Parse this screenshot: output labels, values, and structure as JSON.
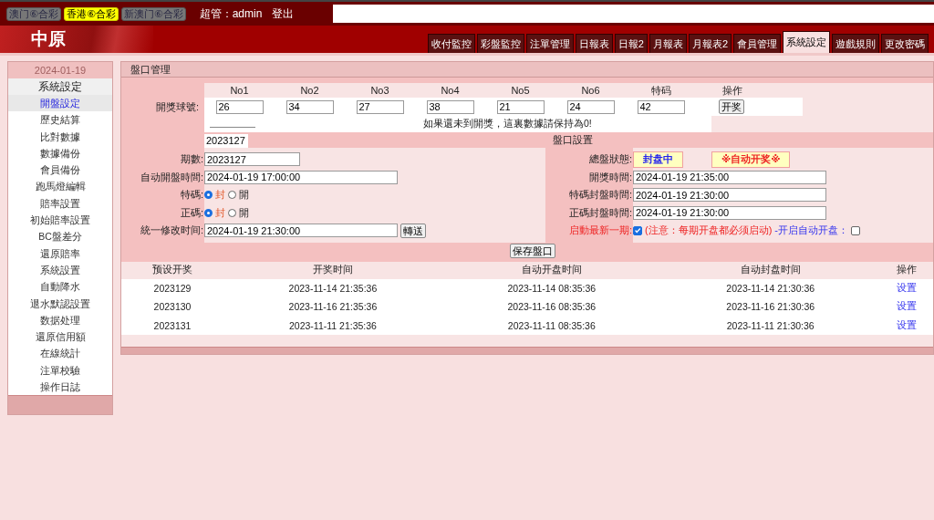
{
  "top_bar": {
    "lotteries": [
      {
        "label": "澳门⑥合彩",
        "selected": false
      },
      {
        "label": "香港⑥合彩",
        "selected": true
      },
      {
        "label": "新澳门⑥合彩",
        "selected": false
      }
    ],
    "user": "超管：admin",
    "logout": "登出"
  },
  "logo": "中原",
  "tabs": [
    {
      "label": "收付監控",
      "selected": false
    },
    {
      "label": "彩盤監控",
      "selected": false
    },
    {
      "label": "注單管理",
      "selected": false
    },
    {
      "label": "日報表",
      "selected": false
    },
    {
      "label": "日報2",
      "selected": false
    },
    {
      "label": "月報表",
      "selected": false
    },
    {
      "label": "月報表2",
      "selected": false
    },
    {
      "label": "會員管理",
      "selected": false
    },
    {
      "label": "系統設定",
      "selected": true
    },
    {
      "label": "遊戲規則",
      "selected": false
    },
    {
      "label": "更改密碼",
      "selected": false
    }
  ],
  "sidebar": {
    "date": "2024-01-19",
    "title": "系統設定",
    "items": [
      {
        "label": "開盤設定",
        "selected": true
      },
      {
        "label": "歷史結算",
        "selected": false
      },
      {
        "label": "比對數據",
        "selected": false
      },
      {
        "label": "數據備份",
        "selected": false
      },
      {
        "label": "會員備份",
        "selected": false
      },
      {
        "label": "跑馬燈編輯",
        "selected": false
      },
      {
        "label": "賠率設置",
        "selected": false
      },
      {
        "label": "初始賠率設置",
        "selected": false
      },
      {
        "label": "BC盤差分",
        "selected": false
      },
      {
        "label": "還原賠率",
        "selected": false
      },
      {
        "label": "系統設置",
        "selected": false
      },
      {
        "label": "自動降水",
        "selected": false
      },
      {
        "label": "退水默認設置",
        "selected": false
      },
      {
        "label": "数据处理",
        "selected": false
      },
      {
        "label": "還原信用額",
        "selected": false
      },
      {
        "label": "在線統計",
        "selected": false
      },
      {
        "label": "注單校驗",
        "selected": false
      },
      {
        "label": "操作日誌",
        "selected": false
      }
    ]
  },
  "panel": {
    "title": "盤口管理",
    "balls": {
      "label": "開獎球號:",
      "columns": [
        "No1",
        "No2",
        "No3",
        "No4",
        "No5",
        "No6",
        "特码"
      ],
      "action_header": "操作",
      "values": [
        "26",
        "34",
        "27",
        "38",
        "21",
        "24",
        "42"
      ],
      "button": "开奖",
      "notice": "如果還未到開獎，這裏數據請保持為0!"
    },
    "issue_field": "2023127",
    "section_title": "盤口設置",
    "left_fields": [
      {
        "kind": "text",
        "label": "期數:",
        "value": "2023127"
      },
      {
        "kind": "text",
        "label": "自动開盤時間:",
        "value": "2024-01-19 17:00:00"
      },
      {
        "kind": "radio",
        "label": "特碼:",
        "options": [
          {
            "label": "封",
            "selected": true
          },
          {
            "label": "開",
            "selected": false
          }
        ]
      },
      {
        "kind": "radio",
        "label": "正碼:",
        "options": [
          {
            "label": "封",
            "selected": true
          },
          {
            "label": "開",
            "selected": false
          }
        ]
      },
      {
        "kind": "text",
        "label": "統一修改时间:",
        "value": "2024-01-19 21:30:00",
        "button": "轉送"
      }
    ],
    "status": {
      "label": "總盤狀態:",
      "state": "封盘中",
      "auto": "※自动开奖※"
    },
    "right_fields": [
      {
        "label": "開獎時間:",
        "value": "2024-01-19 21:35:00"
      },
      {
        "label": "特碼封盤時間:",
        "value": "2024-01-19 21:30:00"
      },
      {
        "label": "正碼封盤時間:",
        "value": "2024-01-19 21:30:00"
      }
    ],
    "start_latest": {
      "label": "启動最新一期:",
      "checked": true,
      "note": "(注意：每期开盘都必须启动)",
      "auto_label": "-开启自动开盘：",
      "auto_checked": false
    },
    "save_button": "保存盤口",
    "table": {
      "columns": [
        "预设开奖",
        "开奖时间",
        "自动开盘时间",
        "自动封盘时间",
        "操作"
      ],
      "rows": [
        {
          "issue": "2023129",
          "draw_time": "2023-11-14 21:35:36",
          "open_time": "2023-11-14 08:35:36",
          "close_time": "2023-11-14 21:30:36",
          "action": "设置"
        },
        {
          "issue": "2023130",
          "draw_time": "2023-11-16 21:35:36",
          "open_time": "2023-11-16 08:35:36",
          "close_time": "2023-11-16 21:30:36",
          "action": "设置"
        },
        {
          "issue": "2023131",
          "draw_time": "2023-11-11 21:35:36",
          "open_time": "2023-11-11 08:35:36",
          "close_time": "2023-11-11 21:30:36",
          "action": "设置"
        }
      ]
    }
  }
}
